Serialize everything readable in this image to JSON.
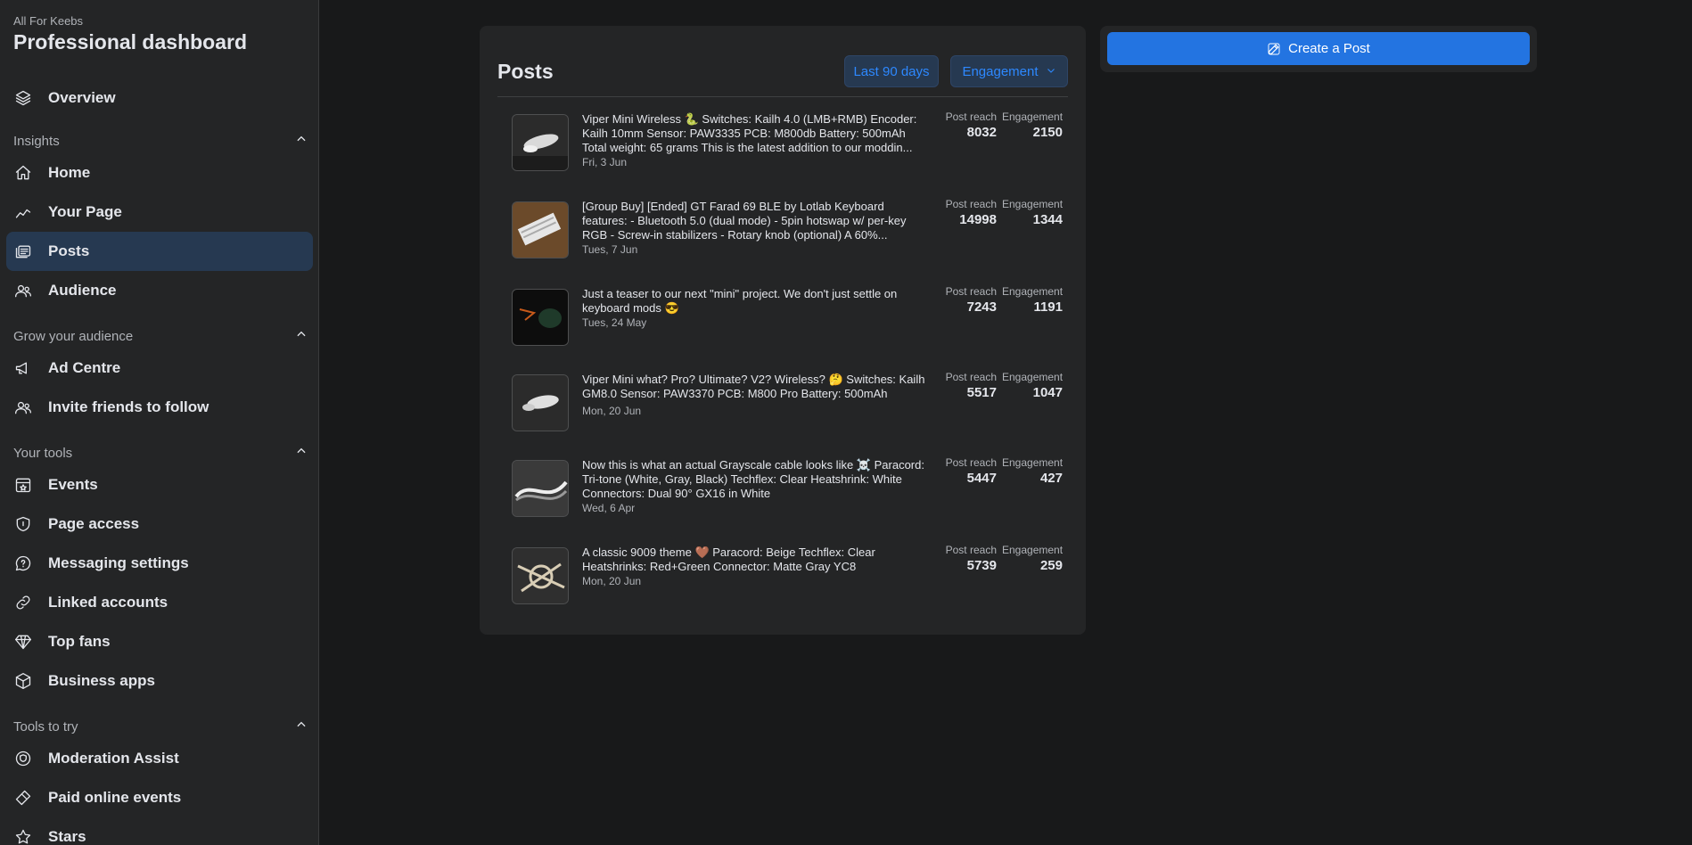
{
  "sidebar": {
    "brand_sub": "All For Keebs",
    "brand_title": "Professional dashboard",
    "overview": "Overview",
    "sections": {
      "insights": "Insights",
      "grow": "Grow your audience",
      "tools": "Your tools",
      "try": "Tools to try"
    },
    "items": {
      "home": "Home",
      "your_page": "Your Page",
      "posts": "Posts",
      "audience": "Audience",
      "ad_centre": "Ad Centre",
      "invite": "Invite friends to follow",
      "events": "Events",
      "page_access": "Page access",
      "messaging": "Messaging settings",
      "linked": "Linked accounts",
      "top_fans": "Top fans",
      "business_apps": "Business apps",
      "moderation": "Moderation Assist",
      "paid_events": "Paid online events",
      "stars": "Stars"
    }
  },
  "posts": {
    "title": "Posts",
    "filter_range": "Last 90 days",
    "filter_metric": "Engagement",
    "reach_label": "Post reach",
    "engagement_label": "Engagement",
    "rows": [
      {
        "text": "Viper Mini Wireless 🐍 Switches: Kailh 4.0 (LMB+RMB) Encoder: Kailh 10mm Sensor: PAW3335 PCB: M800db Battery: 500mAh Total weight: 65 grams This is the latest addition to our moddin...",
        "date": "Fri, 3 Jun",
        "reach": "8032",
        "engagement": "2150"
      },
      {
        "text": "[Group Buy] [Ended] GT Farad 69 BLE by Lotlab Keyboard features: - Bluetooth 5.0 (dual mode) - 5pin hotswap w/ per-key RGB - Screw-in stabilizers - Rotary knob (optional) A 60%...",
        "date": "Tues, 7 Jun",
        "reach": "14998",
        "engagement": "1344"
      },
      {
        "text": "Just a teaser to our next \"mini\" project. We don't just settle on keyboard mods 😎",
        "date": "Tues, 24 May",
        "reach": "7243",
        "engagement": "1191"
      },
      {
        "text": "Viper Mini what? Pro? Ultimate? V2? Wireless? 🤔 Switches: Kailh GM8.0 Sensor: PAW3370 PCB: M800 Pro Battery: 500mAh",
        "date": "Mon, 20 Jun",
        "reach": "5517",
        "engagement": "1047"
      },
      {
        "text": "Now this is what an actual Grayscale cable looks like ☠️ Paracord: Tri-tone (White, Gray, Black) Techflex: Clear Heatshrink: White Connectors: Dual 90° GX16 in White",
        "date": "Wed, 6 Apr",
        "reach": "5447",
        "engagement": "427"
      },
      {
        "text": "A classic 9009 theme 🤎 Paracord: Beige Techflex: Clear Heatshrinks: Red+Green Connector: Matte Gray YC8",
        "date": "Mon, 20 Jun",
        "reach": "5739",
        "engagement": "259"
      }
    ]
  },
  "create_post": {
    "label": "Create a Post"
  },
  "colors": {
    "background": "#18191a",
    "panel": "#242526",
    "accent": "#2374e1",
    "active_nav": "#263951"
  }
}
